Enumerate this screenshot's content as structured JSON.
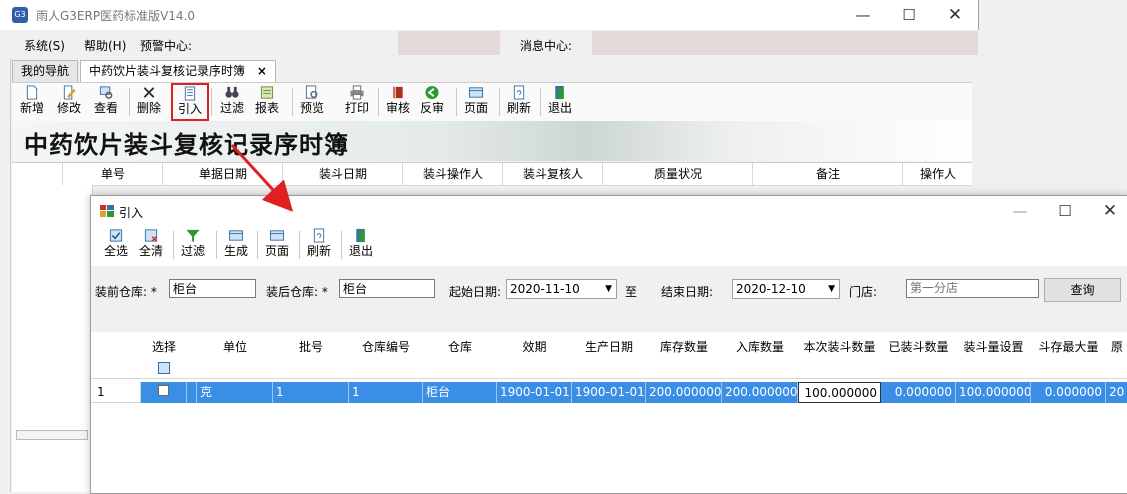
{
  "main_window": {
    "title": "雨人G3ERP医药标准版V14.0",
    "app_icon_text": "G3",
    "menu": [
      "系统(S)",
      "帮助(H)"
    ],
    "warning_center_label": "预警中心:",
    "message_center_label": "消息中心:",
    "tabs": [
      {
        "label": "我的导航",
        "active": false
      },
      {
        "label": "中药饮片装斗复核记录序时簿",
        "active": true
      }
    ],
    "tab_close": "×",
    "toolbar": [
      "新增",
      "修改",
      "查看",
      "删除",
      "引入",
      "过滤",
      "报表",
      "预览",
      "打印",
      "审核",
      "反审",
      "页面",
      "刷新",
      "退出"
    ],
    "banner_title": "中药饮片装斗复核记录序时簿",
    "grid_columns": [
      "单号",
      "单据日期",
      "装斗日期",
      "装斗操作人",
      "装斗复核人",
      "质量状况",
      "备注",
      "操作人"
    ]
  },
  "dialog": {
    "title": "引入",
    "toolbar": [
      "全选",
      "全清",
      "过滤",
      "生成",
      "页面",
      "刷新",
      "退出"
    ],
    "form": {
      "before_wh_label": "装前仓库: *",
      "before_wh_value": "柜台",
      "after_wh_label": "装后仓库: *",
      "after_wh_value": "柜台",
      "start_date_label": "起始日期:",
      "start_date_value": "2020-11-10",
      "to_label": "至",
      "end_date_label": "结束日期:",
      "end_date_value": "2020-12-10",
      "store_label": "门店:",
      "store_placeholder": "第一分店",
      "query_button": "查询"
    },
    "grid_columns": [
      "选择",
      "单位",
      "批号",
      "仓库编号",
      "仓库",
      "效期",
      "生产日期",
      "库存数量",
      "入库数量",
      "本次装斗数量",
      "已装斗数量",
      "装斗量设置",
      "斗存最大量",
      "原"
    ],
    "rows": [
      {
        "index": "1",
        "selected": false,
        "unit": "克",
        "batch": "1",
        "wh_code": "1",
        "warehouse": "柜台",
        "expiry": "1900-01-01",
        "produced": "1900-01-01",
        "stock_qty": "200.000000",
        "in_qty": "200.000000",
        "this_qty": "100.000000",
        "loaded_qty": "0.000000",
        "setting": "100.000000",
        "max_qty": "0.000000",
        "orig": "20"
      }
    ]
  },
  "colors": {
    "selection": "#3a8ee6",
    "highlight_box": "#e02020",
    "arrow": "#e02020"
  }
}
